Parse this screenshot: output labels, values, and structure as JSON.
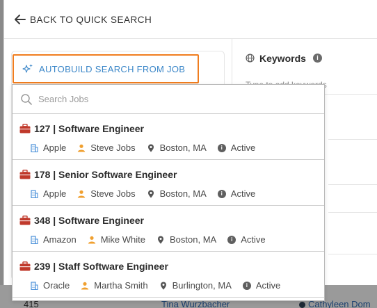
{
  "background": {
    "row_number": "415",
    "name_left": "Tina Wurzbacher",
    "name_right": "Cathyleen Dom"
  },
  "header": {
    "back_label": "BACK TO QUICK SEARCH"
  },
  "autobuild": {
    "label": "AUTOBUILD SEARCH FROM JOB"
  },
  "keywords": {
    "title": "Keywords",
    "placeholder": "Type to add keywords"
  },
  "dropdown": {
    "search_placeholder": "Search Jobs",
    "jobs": [
      {
        "title": "127 | Software Engineer",
        "company": "Apple",
        "owner": "Steve Jobs",
        "location": "Boston, MA",
        "status": "Active"
      },
      {
        "title": "178 | Senior Software Engineer",
        "company": "Apple",
        "owner": "Steve Jobs",
        "location": "Boston, MA",
        "status": "Active"
      },
      {
        "title": "348 | Software Engineer",
        "company": "Amazon",
        "owner": "Mike White",
        "location": "Boston, MA",
        "status": "Active"
      },
      {
        "title": "239 | Staff Software Engineer",
        "company": "Oracle",
        "owner": "Martha Smith",
        "location": "Burlington, MA",
        "status": "Active"
      }
    ]
  },
  "colors": {
    "accent_orange": "#f07d1f",
    "link_blue": "#3a86c8",
    "job_icon_red": "#c0392b",
    "company_icon_blue": "#4a90d9",
    "owner_icon_orange": "#f0a030"
  },
  "icons": {
    "back": "arrow-left-icon",
    "autobuild": "sparkle-icon",
    "keywords": "globe-icon",
    "search": "search-icon",
    "job": "briefcase-icon",
    "company": "building-icon",
    "owner": "person-icon",
    "location": "map-pin-icon",
    "status": "info-icon"
  }
}
